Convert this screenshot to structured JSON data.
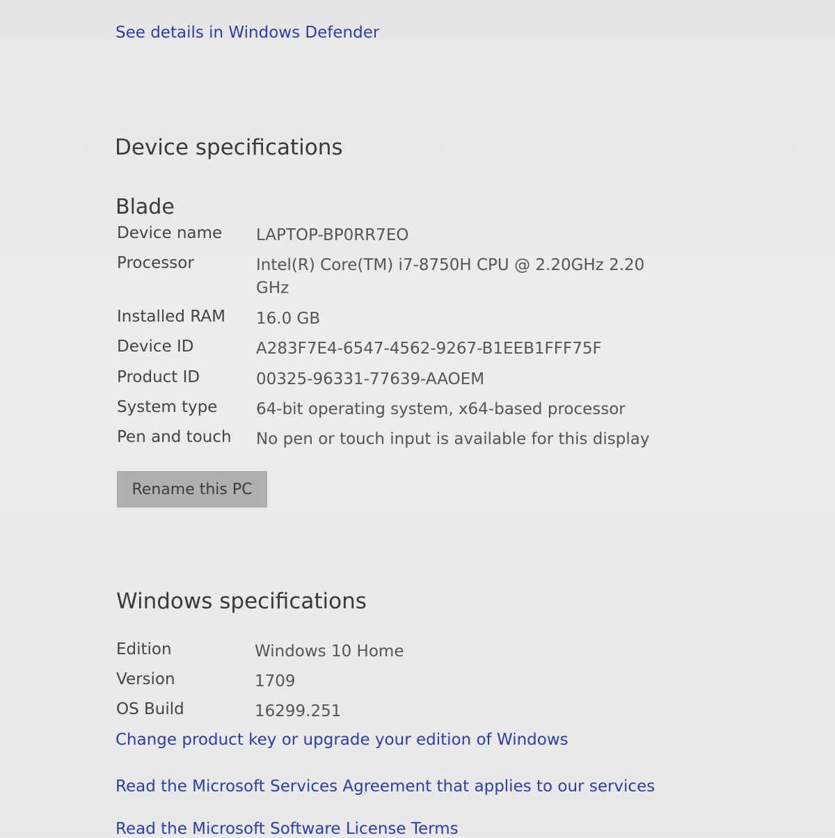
{
  "links": {
    "defender": "See details in Windows Defender",
    "product_key": "Change product key or upgrade your edition of Windows",
    "services_agreement": "Read the Microsoft Services Agreement that applies to our services",
    "license_terms": "Read the Microsoft Software License Terms"
  },
  "device_specs": {
    "title": "Device specifications",
    "device_heading": "Blade",
    "rows": [
      {
        "label": "Device name",
        "value": "LAPTOP-BP0RR7EO"
      },
      {
        "label": "Processor",
        "value": "Intel(R) Core(TM) i7-8750H CPU @ 2.20GHz   2.20 GHz"
      },
      {
        "label": "Installed RAM",
        "value": "16.0 GB"
      },
      {
        "label": "Device ID",
        "value": "A283F7E4-6547-4562-9267-B1EEB1FFF75F"
      },
      {
        "label": "Product ID",
        "value": "00325-96331-77639-AAOEM"
      },
      {
        "label": "System type",
        "value": "64-bit operating system, x64-based processor"
      },
      {
        "label": "Pen and touch",
        "value": "No pen or touch input is available for this display"
      }
    ],
    "rename_button": "Rename this PC"
  },
  "windows_specs": {
    "title": "Windows specifications",
    "rows": [
      {
        "label": "Edition",
        "value": "Windows 10 Home"
      },
      {
        "label": "Version",
        "value": "1709"
      },
      {
        "label": "OS Build",
        "value": "16299.251"
      }
    ]
  },
  "colors": {
    "link": "#2a3fa8",
    "background": "#e9e9e9",
    "button": "#b0b0b0"
  }
}
